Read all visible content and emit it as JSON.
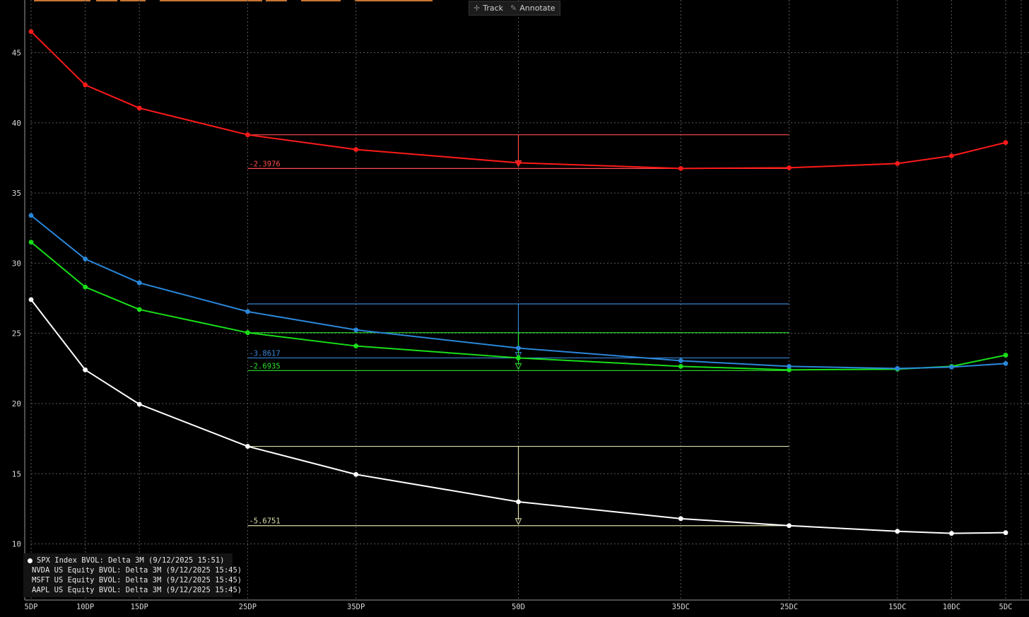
{
  "toolbar": {
    "track_label": "Track",
    "annotate_label": "Annotate"
  },
  "colors": {
    "background": "#000000",
    "grid": "#5a5a5a",
    "axis_text": "#d8d8d8",
    "accent_bar": "#c87533"
  },
  "chart_data": {
    "type": "line",
    "title": "",
    "xlabel": "",
    "ylabel": "",
    "categories": [
      "5DP",
      "10DP",
      "15DP",
      "25DP",
      "35DP",
      "50D",
      "35DC",
      "25DC",
      "15DC",
      "10DC",
      "5DC"
    ],
    "x_positions": [
      5,
      10,
      15,
      25,
      35,
      50,
      65,
      75,
      85,
      90,
      95
    ],
    "xlim": [
      5,
      95
    ],
    "ylim": [
      6,
      48.5
    ],
    "yticks": [
      10,
      15,
      20,
      25,
      30,
      35,
      40,
      45
    ],
    "grid": true,
    "legend_position": "bottom-left",
    "series": [
      {
        "name": "SPX Index BVOL: Delta 3M (9/12/2025 15:51)",
        "color": "#ffffff",
        "values": [
          27.4,
          22.4,
          19.95,
          16.95,
          14.95,
          13.0,
          11.8,
          11.3,
          10.9,
          10.75,
          10.8
        ]
      },
      {
        "name": "NVDA US Equity BVOL: Delta 3M (9/12/2025 15:45)",
        "color": "#ff1a1a",
        "values": [
          46.5,
          42.7,
          41.05,
          39.15,
          38.1,
          37.15,
          36.75,
          36.8,
          37.1,
          37.65,
          38.6
        ]
      },
      {
        "name": "MSFT US Equity BVOL: Delta 3M (9/12/2025 15:45)",
        "color": "#18e018",
        "values": [
          31.5,
          28.3,
          26.7,
          25.05,
          24.1,
          23.25,
          22.65,
          22.4,
          22.45,
          22.65,
          23.45
        ]
      },
      {
        "name": "AAPL US Equity BVOL: Delta 3M (9/12/2025 15:45)",
        "color": "#2a86d8",
        "values": [
          33.4,
          30.3,
          28.6,
          26.55,
          25.25,
          23.95,
          23.05,
          22.65,
          22.5,
          22.6,
          22.85
        ]
      }
    ],
    "annotations": [
      {
        "label": "-2.3976",
        "color": "#ff4a4a",
        "top": 39.15,
        "bottom": 36.75,
        "x_start": 25,
        "x_end": 75,
        "arrow_x": 50,
        "arrow_y": 37.0
      },
      {
        "label": "-3.8617",
        "color": "#3a84d4",
        "top": 27.1,
        "bottom": 23.25,
        "x_start": 25,
        "x_end": 75,
        "arrow_x": 50,
        "arrow_y": 23.35
      },
      {
        "label": "-2.6935",
        "color": "#2be02b",
        "top": 25.05,
        "bottom": 22.35,
        "x_start": 25,
        "x_end": 75,
        "arrow_x": 50,
        "arrow_y": 22.55
      },
      {
        "label": "-5.6751",
        "color": "#dcdca8",
        "top": 16.95,
        "bottom": 11.3,
        "x_start": 25,
        "x_end": 75,
        "arrow_x": 50,
        "arrow_y": 11.5
      }
    ]
  }
}
